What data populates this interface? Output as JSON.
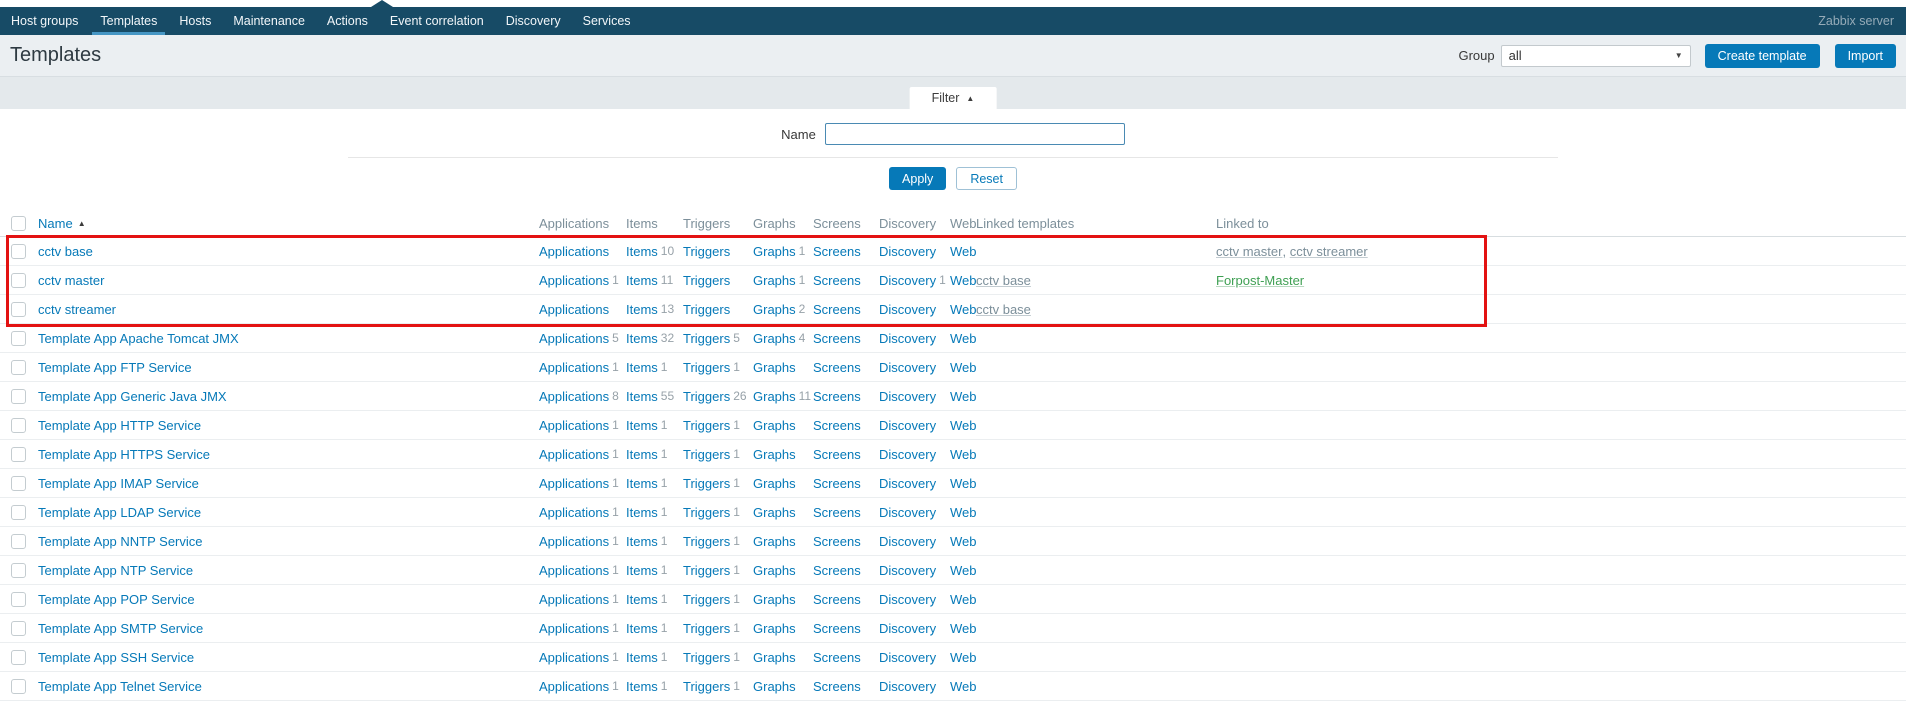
{
  "navbar": {
    "items": [
      {
        "label": "Host groups",
        "active": false
      },
      {
        "label": "Templates",
        "active": true
      },
      {
        "label": "Hosts",
        "active": false
      },
      {
        "label": "Maintenance",
        "active": false
      },
      {
        "label": "Actions",
        "active": false
      },
      {
        "label": "Event correlation",
        "active": false
      },
      {
        "label": "Discovery",
        "active": false
      },
      {
        "label": "Services",
        "active": false
      }
    ],
    "server_name": "Zabbix server"
  },
  "header": {
    "title": "Templates",
    "group_label": "Group",
    "group_value": "all",
    "create_button": "Create template",
    "import_button": "Import"
  },
  "filter": {
    "tab_label": "Filter",
    "collapse_icon": "▲",
    "name_label": "Name",
    "name_value": "",
    "apply_label": "Apply",
    "reset_label": "Reset"
  },
  "table": {
    "columns": [
      "Name",
      "Applications",
      "Items",
      "Triggers",
      "Graphs",
      "Screens",
      "Discovery",
      "Web",
      "Linked templates",
      "Linked to"
    ],
    "sort_column": "Name",
    "sort_order_icon": "▲",
    "rows": [
      {
        "name": "cctv base",
        "counts": [
          null,
          10,
          null,
          1,
          null,
          null,
          null
        ],
        "linked_templates": [],
        "linked_to": [
          {
            "text": "cctv master",
            "kind": "template"
          },
          {
            "text": "cctv streamer",
            "kind": "template"
          }
        ],
        "highlighted": true
      },
      {
        "name": "cctv master",
        "counts": [
          1,
          11,
          null,
          1,
          null,
          1,
          null
        ],
        "linked_templates": [
          "cctv base"
        ],
        "linked_to": [
          {
            "text": "Forpost-Master",
            "kind": "host"
          }
        ],
        "highlighted": true
      },
      {
        "name": "cctv streamer",
        "counts": [
          null,
          13,
          null,
          2,
          null,
          null,
          null
        ],
        "linked_templates": [
          "cctv base"
        ],
        "linked_to": [],
        "highlighted": true
      },
      {
        "name": "Template App Apache Tomcat JMX",
        "counts": [
          5,
          32,
          5,
          4,
          null,
          null,
          null
        ],
        "linked_templates": [],
        "linked_to": [],
        "highlighted": false
      },
      {
        "name": "Template App FTP Service",
        "counts": [
          1,
          1,
          1,
          null,
          null,
          null,
          null
        ],
        "linked_templates": [],
        "linked_to": [],
        "highlighted": false
      },
      {
        "name": "Template App Generic Java JMX",
        "counts": [
          8,
          55,
          26,
          11,
          null,
          null,
          null
        ],
        "linked_templates": [],
        "linked_to": [],
        "highlighted": false
      },
      {
        "name": "Template App HTTP Service",
        "counts": [
          1,
          1,
          1,
          null,
          null,
          null,
          null
        ],
        "linked_templates": [],
        "linked_to": [],
        "highlighted": false
      },
      {
        "name": "Template App HTTPS Service",
        "counts": [
          1,
          1,
          1,
          null,
          null,
          null,
          null
        ],
        "linked_templates": [],
        "linked_to": [],
        "highlighted": false
      },
      {
        "name": "Template App IMAP Service",
        "counts": [
          1,
          1,
          1,
          null,
          null,
          null,
          null
        ],
        "linked_templates": [],
        "linked_to": [],
        "highlighted": false
      },
      {
        "name": "Template App LDAP Service",
        "counts": [
          1,
          1,
          1,
          null,
          null,
          null,
          null
        ],
        "linked_templates": [],
        "linked_to": [],
        "highlighted": false
      },
      {
        "name": "Template App NNTP Service",
        "counts": [
          1,
          1,
          1,
          null,
          null,
          null,
          null
        ],
        "linked_templates": [],
        "linked_to": [],
        "highlighted": false
      },
      {
        "name": "Template App NTP Service",
        "counts": [
          1,
          1,
          1,
          null,
          null,
          null,
          null
        ],
        "linked_templates": [],
        "linked_to": [],
        "highlighted": false
      },
      {
        "name": "Template App POP Service",
        "counts": [
          1,
          1,
          1,
          null,
          null,
          null,
          null
        ],
        "linked_templates": [],
        "linked_to": [],
        "highlighted": false
      },
      {
        "name": "Template App SMTP Service",
        "counts": [
          1,
          1,
          1,
          null,
          null,
          null,
          null
        ],
        "linked_templates": [],
        "linked_to": [],
        "highlighted": false
      },
      {
        "name": "Template App SSH Service",
        "counts": [
          1,
          1,
          1,
          null,
          null,
          null,
          null
        ],
        "linked_templates": [],
        "linked_to": [],
        "highlighted": false
      },
      {
        "name": "Template App Telnet Service",
        "counts": [
          1,
          1,
          1,
          null,
          null,
          null,
          null
        ],
        "linked_templates": [],
        "linked_to": [],
        "highlighted": false
      }
    ]
  },
  "highlight_box": {
    "color": "#e31212"
  },
  "colors": {
    "accent_blue": "#0679b8",
    "nav_background": "#174b66",
    "nav_active_underline": "#4696c4",
    "host_green": "#3fa053",
    "muted_gray": "#7c8f9a"
  }
}
